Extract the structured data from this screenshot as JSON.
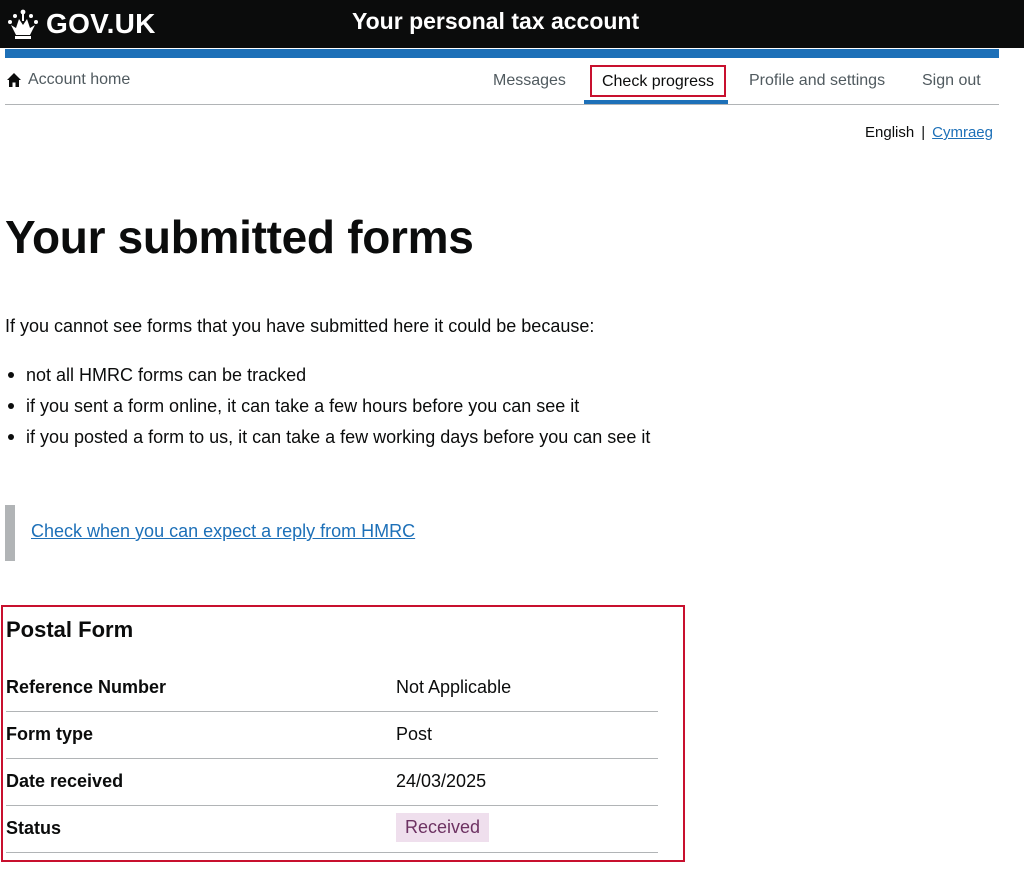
{
  "header": {
    "brand": "GOV.UK",
    "service_name": "Your personal tax account"
  },
  "nav": {
    "home_label": "Account home",
    "items": [
      {
        "label": "Messages"
      },
      {
        "label": "Check progress",
        "active": true
      },
      {
        "label": "Profile and settings"
      },
      {
        "label": "Sign out"
      }
    ]
  },
  "language": {
    "current": "English",
    "separator": "|",
    "alternate": "Cymraeg"
  },
  "main": {
    "title": "Your submitted forms",
    "intro": "If you cannot see forms that you have submitted here it could be because:",
    "reasons": [
      "not all HMRC forms can be tracked",
      "if you sent a form online, it can take a few hours before you can see it",
      "if you posted a form to us, it can take a few working days before you can see it"
    ],
    "reply_link": "Check when you can expect a reply from HMRC"
  },
  "form_card": {
    "title": "Postal Form",
    "rows": [
      {
        "key": "Reference Number",
        "value": "Not Applicable"
      },
      {
        "key": "Form type",
        "value": "Post"
      },
      {
        "key": "Date received",
        "value": "24/03/2025"
      },
      {
        "key": "Status",
        "value": "Received"
      }
    ]
  },
  "colors": {
    "header_background": "#0b0c0c",
    "accent_blue": "#1d70b8",
    "highlight_red": "#c8102e",
    "status_tag_background": "#efdfed",
    "status_tag_text": "#6d3262"
  }
}
